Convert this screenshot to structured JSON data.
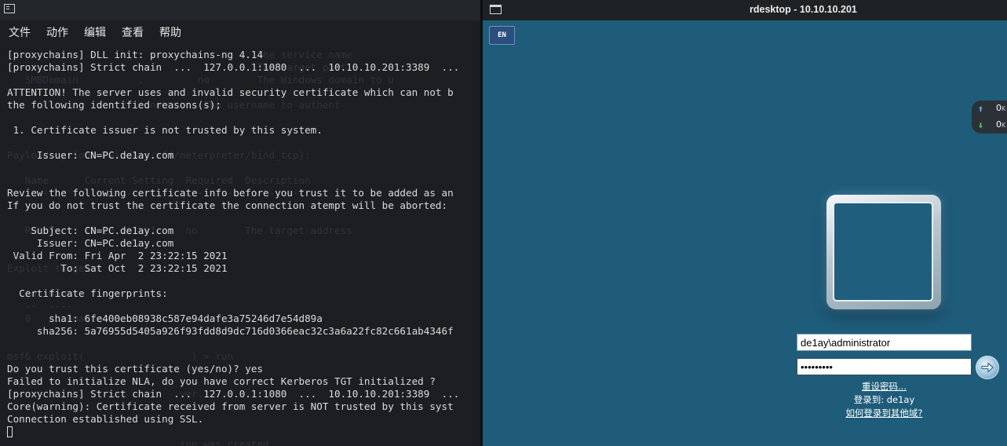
{
  "terminal": {
    "menu": [
      "文件",
      "动作",
      "编辑",
      "查看",
      "帮助"
    ],
    "lines": [
      "[proxychains] DLL init: proxychains-ng 4.14",
      "[proxychains] Strict chain  ...  127.0.0.1:1080  ...  10.10.10.201:3389  ...",
      "",
      "ATTENTION! The server uses and invalid security certificate which can not b",
      "the following identified reasons(s);",
      "",
      " 1. Certificate issuer is not trusted by this system.",
      "",
      "     Issuer: CN=PC.de1ay.com",
      "",
      "",
      "Review the following certificate info before you trust it to be added as an",
      "If you do not trust the certificate the connection atempt will be aborted:",
      "",
      "    Subject: CN=PC.de1ay.com",
      "     Issuer: CN=PC.de1ay.com",
      " Valid From: Fri Apr  2 23:22:15 2021",
      "         To: Sat Oct  2 23:22:15 2021",
      "",
      "  Certificate fingerprints:",
      "",
      "       sha1: 6fe400eb08938c587e94dafe3a75246d7e54d89a",
      "     sha256: 5a76955d5405a926f93fdd8d9dc716d0366eac32c3a6a22fc82c661ab4346f",
      "",
      "",
      "Do you trust this certificate (yes/no)? yes",
      "Failed to initialize NLA, do you have correct Kerberos TGT initialized ?",
      "[proxychains] Strict chain  ...  127.0.0.1:1080  ...  10.10.10.201:3389  ...",
      "Core(warning): Certificate received from server is NOT trusted by this syst",
      "Connection established using SSL."
    ],
    "ghost_lines": [
      "                                          The service name",
      "                                          The target port",
      "   SMBDomain          .         no        The Windows domain to u",
      "                                          ",
      "                   r    no       The username to authent",
      "",
      "",
      "",
      "Payload options (windows/x64/meterpreter/bind_tcp):",
      "",
      "   Name      Current Setting  Required  Description",
      "   ----      ---------------  --------  -----------",
      "",
      "",
      "   RHOST     10.10.10.201     no        The target address",
      "",
      "",
      "Exploit target:",
      "",
      "   Id  Name",
      "   --  ----",
      "   0   Automatic",
      "",
      "",
      "msf6 exploit(                  ) > run",
      "",
      "",
      "                             ver...",
      "                                    ist",
      "",
      "",
      "                             ion was created.",
      "msf6 exploit(                  ) > []"
    ]
  },
  "rdesktop": {
    "title": "rdesktop - 10.10.10.201",
    "lang_button": "EN",
    "net": {
      "up_value": "0",
      "up_unit": "K",
      "down_value": "0",
      "down_unit": "K"
    },
    "login": {
      "username": "de1ay\\administrator",
      "password": "•••••••••",
      "reset_password_link": "重设密码...",
      "login_to": "登录到: de1ay",
      "other_domain_link": "如何登录到其他域?"
    }
  },
  "colors": {
    "terminal_bg": "#1c1e22",
    "terminal_text": "#dcdcdc",
    "desktop_bg": "#1e5c7a",
    "net_up_arrow": "#5aa9e6",
    "net_down_arrow": "#4cc36a"
  },
  "icons": {
    "terminal_window": "terminal-icon",
    "rdesktop_window": "window-icon",
    "submit": "arrow-right-icon",
    "net_up": "arrow-up-icon",
    "net_down": "arrow-down-icon"
  }
}
